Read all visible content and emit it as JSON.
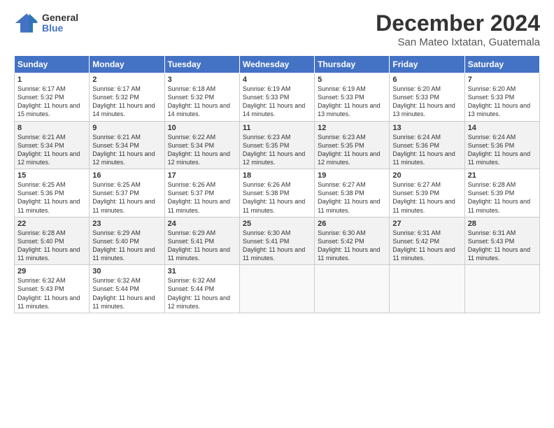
{
  "header": {
    "logo_line1": "General",
    "logo_line2": "Blue",
    "month": "December 2024",
    "location": "San Mateo Ixtatan, Guatemala"
  },
  "weekdays": [
    "Sunday",
    "Monday",
    "Tuesday",
    "Wednesday",
    "Thursday",
    "Friday",
    "Saturday"
  ],
  "weeks": [
    [
      {
        "day": "1",
        "sunrise": "6:17 AM",
        "sunset": "5:32 PM",
        "daylight": "11 hours and 15 minutes."
      },
      {
        "day": "2",
        "sunrise": "6:17 AM",
        "sunset": "5:32 PM",
        "daylight": "11 hours and 14 minutes."
      },
      {
        "day": "3",
        "sunrise": "6:18 AM",
        "sunset": "5:32 PM",
        "daylight": "11 hours and 14 minutes."
      },
      {
        "day": "4",
        "sunrise": "6:19 AM",
        "sunset": "5:33 PM",
        "daylight": "11 hours and 14 minutes."
      },
      {
        "day": "5",
        "sunrise": "6:19 AM",
        "sunset": "5:33 PM",
        "daylight": "11 hours and 13 minutes."
      },
      {
        "day": "6",
        "sunrise": "6:20 AM",
        "sunset": "5:33 PM",
        "daylight": "11 hours and 13 minutes."
      },
      {
        "day": "7",
        "sunrise": "6:20 AM",
        "sunset": "5:33 PM",
        "daylight": "11 hours and 13 minutes."
      }
    ],
    [
      {
        "day": "8",
        "sunrise": "6:21 AM",
        "sunset": "5:34 PM",
        "daylight": "11 hours and 12 minutes."
      },
      {
        "day": "9",
        "sunrise": "6:21 AM",
        "sunset": "5:34 PM",
        "daylight": "11 hours and 12 minutes."
      },
      {
        "day": "10",
        "sunrise": "6:22 AM",
        "sunset": "5:34 PM",
        "daylight": "11 hours and 12 minutes."
      },
      {
        "day": "11",
        "sunrise": "6:23 AM",
        "sunset": "5:35 PM",
        "daylight": "11 hours and 12 minutes."
      },
      {
        "day": "12",
        "sunrise": "6:23 AM",
        "sunset": "5:35 PM",
        "daylight": "11 hours and 12 minutes."
      },
      {
        "day": "13",
        "sunrise": "6:24 AM",
        "sunset": "5:36 PM",
        "daylight": "11 hours and 11 minutes."
      },
      {
        "day": "14",
        "sunrise": "6:24 AM",
        "sunset": "5:36 PM",
        "daylight": "11 hours and 11 minutes."
      }
    ],
    [
      {
        "day": "15",
        "sunrise": "6:25 AM",
        "sunset": "5:36 PM",
        "daylight": "11 hours and 11 minutes."
      },
      {
        "day": "16",
        "sunrise": "6:25 AM",
        "sunset": "5:37 PM",
        "daylight": "11 hours and 11 minutes."
      },
      {
        "day": "17",
        "sunrise": "6:26 AM",
        "sunset": "5:37 PM",
        "daylight": "11 hours and 11 minutes."
      },
      {
        "day": "18",
        "sunrise": "6:26 AM",
        "sunset": "5:38 PM",
        "daylight": "11 hours and 11 minutes."
      },
      {
        "day": "19",
        "sunrise": "6:27 AM",
        "sunset": "5:38 PM",
        "daylight": "11 hours and 11 minutes."
      },
      {
        "day": "20",
        "sunrise": "6:27 AM",
        "sunset": "5:39 PM",
        "daylight": "11 hours and 11 minutes."
      },
      {
        "day": "21",
        "sunrise": "6:28 AM",
        "sunset": "5:39 PM",
        "daylight": "11 hours and 11 minutes."
      }
    ],
    [
      {
        "day": "22",
        "sunrise": "6:28 AM",
        "sunset": "5:40 PM",
        "daylight": "11 hours and 11 minutes."
      },
      {
        "day": "23",
        "sunrise": "6:29 AM",
        "sunset": "5:40 PM",
        "daylight": "11 hours and 11 minutes."
      },
      {
        "day": "24",
        "sunrise": "6:29 AM",
        "sunset": "5:41 PM",
        "daylight": "11 hours and 11 minutes."
      },
      {
        "day": "25",
        "sunrise": "6:30 AM",
        "sunset": "5:41 PM",
        "daylight": "11 hours and 11 minutes."
      },
      {
        "day": "26",
        "sunrise": "6:30 AM",
        "sunset": "5:42 PM",
        "daylight": "11 hours and 11 minutes."
      },
      {
        "day": "27",
        "sunrise": "6:31 AM",
        "sunset": "5:42 PM",
        "daylight": "11 hours and 11 minutes."
      },
      {
        "day": "28",
        "sunrise": "6:31 AM",
        "sunset": "5:43 PM",
        "daylight": "11 hours and 11 minutes."
      }
    ],
    [
      {
        "day": "29",
        "sunrise": "6:32 AM",
        "sunset": "5:43 PM",
        "daylight": "11 hours and 11 minutes."
      },
      {
        "day": "30",
        "sunrise": "6:32 AM",
        "sunset": "5:44 PM",
        "daylight": "11 hours and 11 minutes."
      },
      {
        "day": "31",
        "sunrise": "6:32 AM",
        "sunset": "5:44 PM",
        "daylight": "11 hours and 12 minutes."
      },
      null,
      null,
      null,
      null
    ]
  ]
}
